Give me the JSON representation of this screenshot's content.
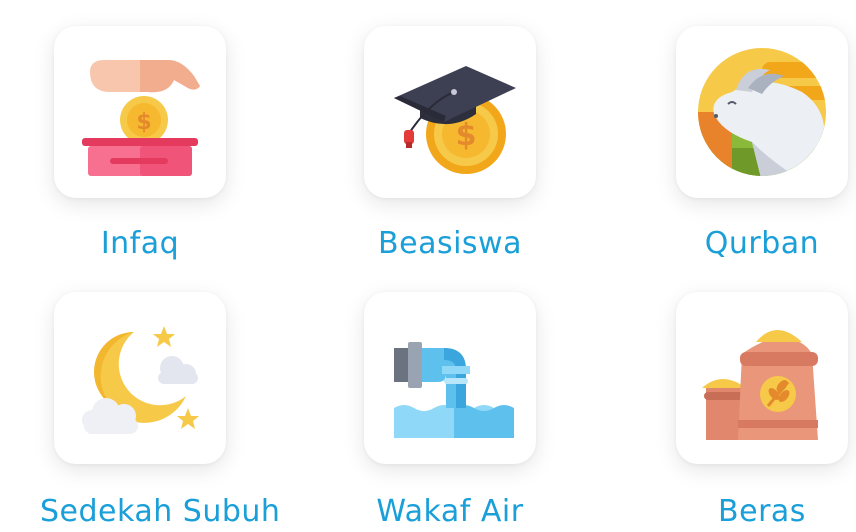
{
  "accent_color": "#1a9fd8",
  "categories": [
    {
      "label": "Infaq",
      "icon": "donation-box-icon"
    },
    {
      "label": "Beasiswa",
      "icon": "graduation-cap-coin-icon"
    },
    {
      "label": "Qurban",
      "icon": "goat-icon"
    },
    {
      "label": "Sedekah Subuh",
      "icon": "crescent-moon-icon"
    },
    {
      "label": "Wakaf Air",
      "icon": "water-pipe-icon"
    },
    {
      "label": "Beras",
      "icon": "rice-sack-icon"
    }
  ]
}
